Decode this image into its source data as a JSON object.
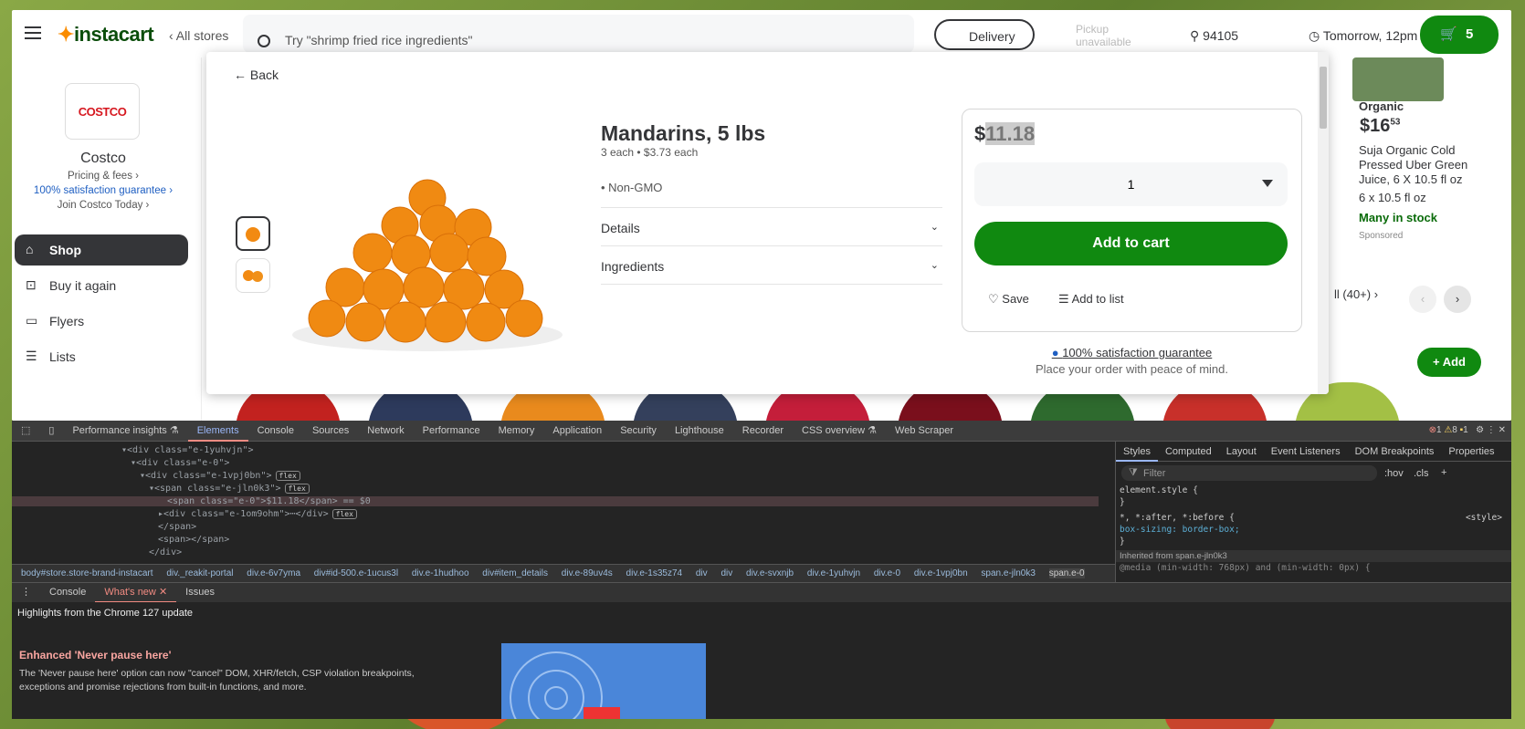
{
  "header": {
    "logo_text": "instacart",
    "all_stores": "‹ All stores",
    "search_placeholder": "Try \"shrimp fried rice ingredients\"",
    "delivery": "Delivery",
    "pickup": "Pickup unavailable",
    "zip": "94105",
    "time": "Tomorrow, 12pm",
    "cart_count": "5"
  },
  "sidebar": {
    "store_logo": "COSTCO",
    "store_name": "Costco",
    "pricing": "Pricing & fees ›",
    "guarantee": "100% satisfaction guarantee ›",
    "join": "Join Costco Today ›",
    "nav": [
      {
        "label": "Shop"
      },
      {
        "label": "Buy it again"
      },
      {
        "label": "Flyers"
      },
      {
        "label": "Lists"
      }
    ]
  },
  "right_card": {
    "badge": "Organic",
    "price_dollars": "$16",
    "price_cents": "53",
    "name": "Suja Organic Cold Pressed Uber Green Juice, 6 X 10.5 fl oz",
    "size": "6 x 10.5 fl oz",
    "stock": "Many in stock",
    "sponsored": "Sponsored",
    "view_all": "ll (40+) ›",
    "add": "Add"
  },
  "modal": {
    "back": "Back",
    "title": "Mandarins, 5 lbs",
    "subtitle": "3 each  • $3.73 each",
    "attribute": "• Non-GMO",
    "details": "Details",
    "ingredients": "Ingredients",
    "price_symbol": "$",
    "price_value": "11.18",
    "quantity": "1",
    "add_to_cart": "Add to cart",
    "save": "Save",
    "add_to_list": "Add to list",
    "guarantee": "100% satisfaction guarantee",
    "guarantee_sub": "Place your order with peace of mind."
  },
  "devtools": {
    "tabs": [
      "Performance insights ⚗",
      "Elements",
      "Console",
      "Sources",
      "Network",
      "Performance",
      "Memory",
      "Application",
      "Security",
      "Lighthouse",
      "Recorder",
      "CSS overview ⚗",
      "Web Scraper"
    ],
    "errors": "1",
    "warnings": "8",
    "issues": "1",
    "elements": [
      {
        "indent": 120,
        "text": "▾<div class=\"e-1yuhvjn\">"
      },
      {
        "indent": 130,
        "text": "▾<div class=\"e-0\">"
      },
      {
        "indent": 140,
        "text": "▾<div class=\"e-1vpj0bn\">",
        "badge": "flex"
      },
      {
        "indent": 150,
        "text": "▾<span class=\"e-jln0k3\">",
        "badge": "flex"
      },
      {
        "indent": 160,
        "text": "<span class=\"e-0\">$11.18</span> == $0",
        "selected": true
      },
      {
        "indent": 160,
        "text": "▸<div class=\"e-1om9ohm\">⋯</div>",
        "badge": "flex"
      },
      {
        "indent": 150,
        "text": "</span>"
      },
      {
        "indent": 150,
        "text": "<span></span>"
      },
      {
        "indent": 140,
        "text": "</div>"
      }
    ],
    "breadcrumbs": [
      "body#store.store-brand-instacart",
      "div._reakit-portal",
      "div.e-6v7yma",
      "div#id-500.e-1ucus3l",
      "div.e-1hudhoo",
      "div#item_details",
      "div.e-89uv4s",
      "div.e-1s35z74",
      "div",
      "div",
      "div.e-svxnjb",
      "div.e-1yuhvjn",
      "div.e-0",
      "div.e-1vpj0bn",
      "span.e-jln0k3",
      "span.e-0"
    ],
    "style_tabs": [
      "Styles",
      "Computed",
      "Layout",
      "Event Listeners",
      "DOM Breakpoints",
      "Properties"
    ],
    "filter_placeholder": "Filter",
    "hov": ":hov",
    "cls": ".cls",
    "style_lines": [
      "element.style {",
      "}",
      "*, *:after, *:before {",
      "  box-sizing: border-box;",
      "}",
      "Inherited from span.e-jln0k3",
      "@media (min-width: 768px) and (min-width: 0px) {"
    ],
    "style_source": "<style>",
    "drawer_tabs": [
      "Console",
      "What's new",
      "Issues"
    ],
    "whats_new_head": "Highlights from the Chrome 127 update",
    "whats_new_title": "Enhanced 'Never pause here'",
    "whats_new_text": "The 'Never pause here' option can now \"cancel\" DOM, XHR/fetch, CSP violation breakpoints, exceptions and promise rejections from built-in functions, and more."
  },
  "colors": {
    "brand_green": "#108910",
    "accent_orange": "#fa8c00"
  }
}
